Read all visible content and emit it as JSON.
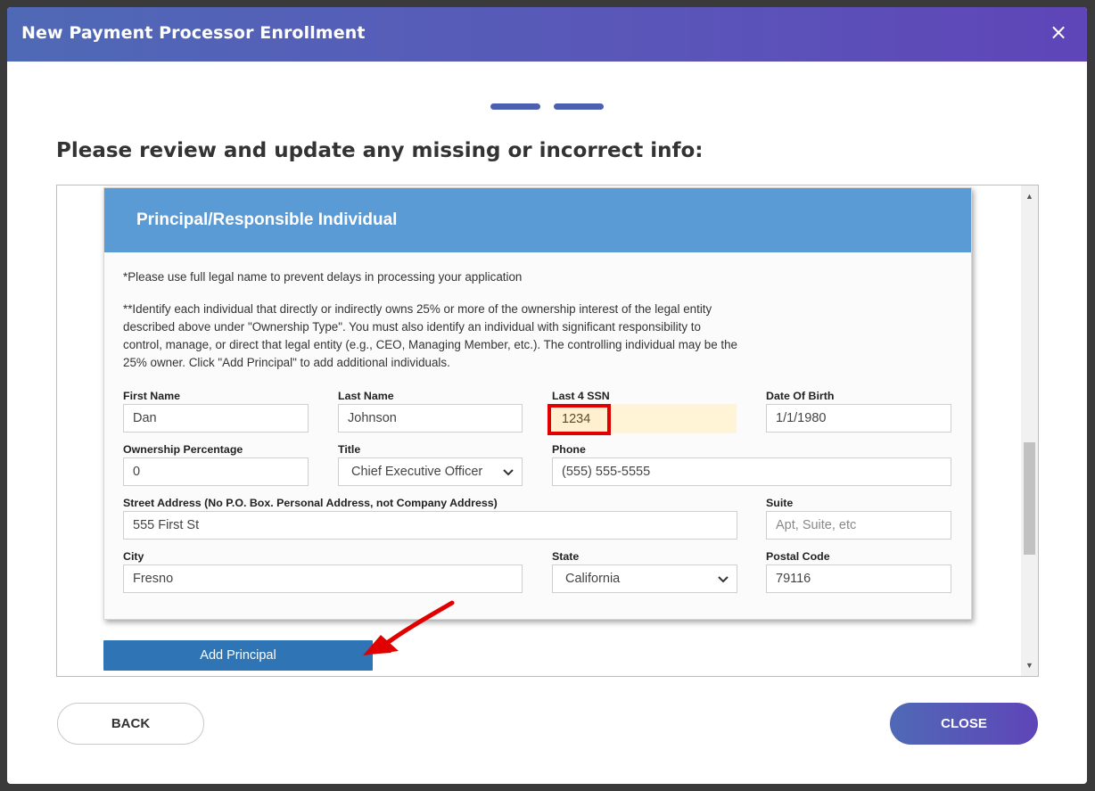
{
  "header": {
    "title": "New Payment Processor Enrollment",
    "close_icon": "×"
  },
  "steps": {
    "count": 2
  },
  "instruction": "Please review and update any missing or incorrect info:",
  "section": {
    "title": "Principal/Responsible Individual",
    "note1": "*Please use full legal name to prevent delays in processing your application",
    "note2": "**Identify each individual that directly or indirectly owns 25% or more of the ownership interest of the legal entity described above under \"Ownership Type\". You must also identify an individual with significant responsibility to control, manage, or direct that legal entity (e.g., CEO, Managing Member, etc.). The controlling individual may be the 25% owner. Click \"Add Principal\" to add additional individuals."
  },
  "fields": {
    "first_name": {
      "label": "First Name",
      "value": "Dan"
    },
    "last_name": {
      "label": "Last Name",
      "value": "Johnson"
    },
    "ssn": {
      "label": "Last 4 SSN",
      "value": "1234"
    },
    "dob": {
      "label": "Date Of Birth",
      "value": "1/1/1980"
    },
    "ownership": {
      "label": "Ownership Percentage",
      "value": "0"
    },
    "title": {
      "label": "Title",
      "value": "Chief Executive Officer"
    },
    "phone": {
      "label": "Phone",
      "value": "(555) 555-5555"
    },
    "street": {
      "label": "Street Address (No P.O. Box. Personal Address, not Company Address)",
      "value": "555 First St"
    },
    "suite": {
      "label": "Suite",
      "placeholder": "Apt, Suite, etc"
    },
    "city": {
      "label": "City",
      "value": "Fresno"
    },
    "state": {
      "label": "State",
      "value": "California"
    },
    "postal": {
      "label": "Postal Code",
      "value": "79116"
    }
  },
  "buttons": {
    "add_principal": "Add Principal",
    "back": "BACK",
    "close": "CLOSE"
  },
  "colors": {
    "header_start": "#4f69b6",
    "header_end": "#5f45b8",
    "card_header": "#5b9bd5",
    "add_button": "#2f74b5",
    "highlight": "#e00000",
    "annotation_arrow": "#e00000"
  }
}
